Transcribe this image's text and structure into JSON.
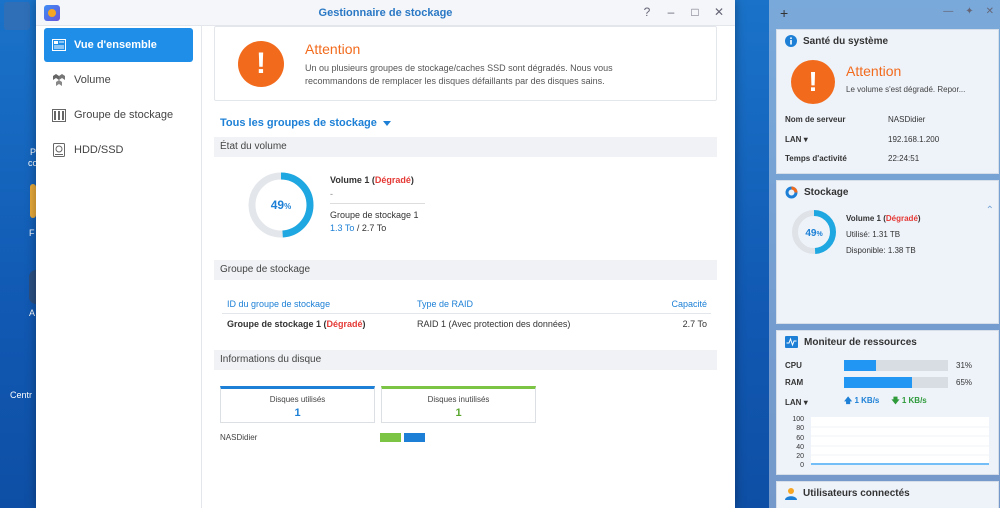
{
  "window": {
    "title": "Gestionnaire de stockage"
  },
  "sidebar": {
    "items": [
      {
        "label": "Vue d'ensemble",
        "icon": "overview-icon"
      },
      {
        "label": "Volume",
        "icon": "volume-icon"
      },
      {
        "label": "Groupe de stockage",
        "icon": "storage-pool-icon"
      },
      {
        "label": "HDD/SSD",
        "icon": "hdd-icon"
      }
    ]
  },
  "alert": {
    "title": "Attention",
    "message": "Un ou plusieurs groupes de stockage/caches SSD sont dégradés. Nous vous recommandons de remplacer les disques défaillants par des disques sains."
  },
  "group_select": {
    "label": "Tous les groupes de stockage"
  },
  "volume_state": {
    "header": "État du volume",
    "percent": 49,
    "percent_unit": "%",
    "name": "Volume 1",
    "status": "Dégradé",
    "dash": "-",
    "pool": "Groupe de stockage 1",
    "used": "1.3 To",
    "total": "2.7 To",
    "separator": " / "
  },
  "storage_pool": {
    "header": "Groupe de stockage",
    "columns": [
      "ID du groupe de stockage",
      "Type de RAID",
      "Capacité"
    ],
    "row": {
      "name": "Groupe de stockage 1",
      "status": "Dégradé",
      "raid": "RAID 1 (Avec protection des données)",
      "capacity": "2.7 To"
    }
  },
  "disk_info": {
    "header": "Informations du disque",
    "used_label": "Disques utilisés",
    "used_count": "1",
    "unused_label": "Disques inutilisés",
    "unused_count": "1",
    "nas_name": "NASDidier",
    "bay_colors": [
      "#7cc444",
      "#1d80d6"
    ]
  },
  "widgets": {
    "health": {
      "title": "Santé du système",
      "status": "Attention",
      "message": "Le volume s'est dégradé. Repor...",
      "rows": [
        {
          "key": "Nom de serveur",
          "value": "NASDidier"
        },
        {
          "key": "LAN",
          "value": "192.168.1.200"
        },
        {
          "key": "Temps d'activité",
          "value": "22:24:51"
        }
      ]
    },
    "storage": {
      "title": "Stockage",
      "percent": 49,
      "percent_unit": "%",
      "volume": "Volume 1",
      "status": "Dégradé",
      "used_label": "Utilisé:",
      "used": "1.31 TB",
      "free_label": "Disponible:",
      "free": "1.38 TB"
    },
    "monitor": {
      "title": "Moniteur de ressources",
      "cpu_label": "CPU",
      "cpu_percent": 31,
      "cpu_text": "31%",
      "ram_label": "RAM",
      "ram_percent": 65,
      "ram_text": "65%",
      "lan_label": "LAN",
      "lan_up": "1 KB/s",
      "lan_down": "1 KB/s",
      "chart_ticks": [
        "100",
        "80",
        "60",
        "40",
        "20",
        "0"
      ]
    },
    "users": {
      "title": "Utilisateurs connectés"
    }
  },
  "desktop": {
    "labels": [
      "P",
      "co",
      "F",
      "A",
      "Centr"
    ]
  },
  "colors": {
    "accent": "#1d80d6",
    "warning": "#f26b1d",
    "degraded": "#e53935",
    "ring_track": "#e3e6ea"
  }
}
